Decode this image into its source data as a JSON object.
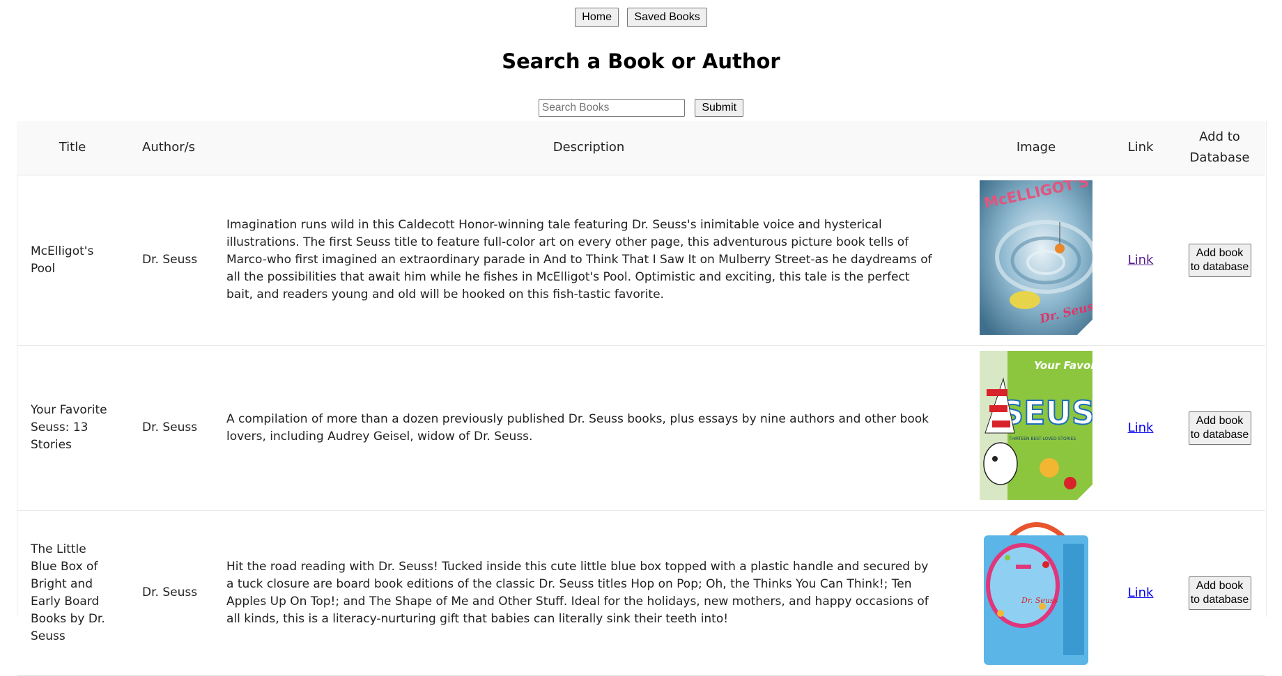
{
  "nav": {
    "home_label": "Home",
    "saved_label": "Saved Books"
  },
  "page_title": "Search a Book or Author",
  "search": {
    "placeholder": "Search Books",
    "value": "",
    "submit_label": "Submit"
  },
  "table": {
    "headers": {
      "title": "Title",
      "authors": "Author/s",
      "description": "Description",
      "image": "Image",
      "link": "Link",
      "add": "Add to Database"
    },
    "rows": [
      {
        "title": "McElligot's Pool",
        "author": "Dr. Seuss",
        "description": "Imagination runs wild in this Caldecott Honor-winning tale featuring Dr. Seuss's inimitable voice and hysterical illustrations. The first Seuss title to feature full-color art on every other page, this adventurous picture book tells of Marco-who first imagined an extraordinary parade in And to Think That I Saw It on Mulberry Street-as he daydreams of all the possibilities that await him while he fishes in McElligot's Pool. Optimistic and exciting, this tale is the perfect bait, and readers young and old will be hooked on this fish-tastic favorite.",
        "cover_text": "McELLIGOT'S POOL",
        "cover_author": "Dr. Seuss",
        "link_label": "Link",
        "add_label": "Add book to database"
      },
      {
        "title": "Your Favorite Seuss: 13 Stories",
        "author": "Dr. Seuss",
        "description": "A compilation of more than a dozen previously published Dr. Seuss books, plus essays by nine authors and other book lovers, including Audrey Geisel, widow of Dr. Seuss.",
        "cover_text_top": "Your Favorite",
        "cover_text_main": "SEUSS",
        "cover_subtitle": "THIRTEEN BEST-LOVED STORIES",
        "link_label": "Link",
        "add_label": "Add book to database"
      },
      {
        "title": "The Little Blue Box of Bright and Early Board Books by Dr. Seuss",
        "author": "Dr. Seuss",
        "description": "Hit the road reading with Dr. Seuss! Tucked inside this cute little blue box topped with a plastic handle and secured by a tuck closure are board book editions of the classic Dr. Seuss titles Hop on Pop; Oh, the Thinks You Can Think!; Ten Apples Up On Top!; and The Shape of Me and Other Stuff. Ideal for the holidays, new mothers, and happy occasions of all kinds, this is a literacy-nurturing gift that babies can literally sink their teeth into!",
        "cover_author": "Dr. Seuss",
        "link_label": "Link",
        "add_label": "Add book to database"
      }
    ]
  },
  "colors": {
    "header_bg": "#f9f9f9",
    "link_visited": "#551a8b",
    "link_unvisited": "#0000ee",
    "border": "#e6e6e6"
  }
}
